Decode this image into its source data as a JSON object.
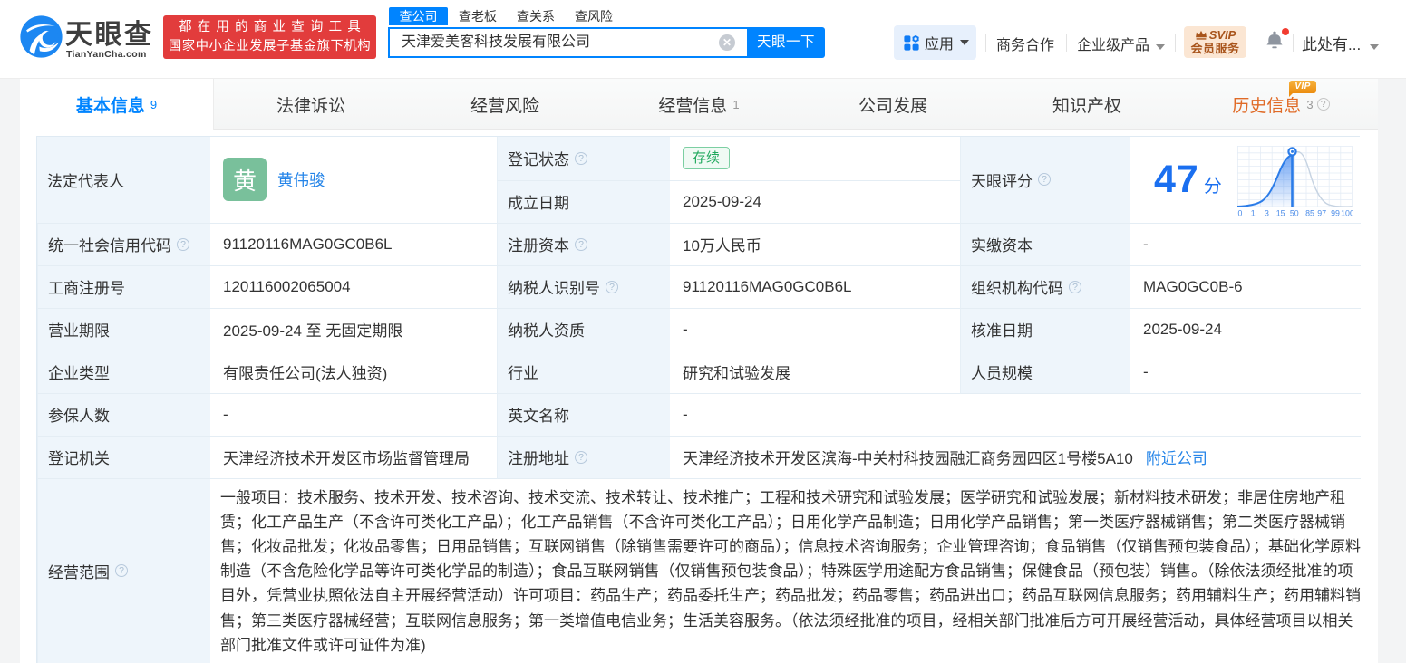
{
  "header": {
    "logo": {
      "title": "天眼查",
      "subtitle": "TianYanCha.com",
      "icon": "tianyancha-eye-swirl"
    },
    "slogan": {
      "line1": "都在用的商业查询工具",
      "line2": "国家中小企业发展子基金旗下机构",
      "bg_color": "#e23c3c"
    },
    "search": {
      "tabs": [
        {
          "label": "查公司",
          "active": true
        },
        {
          "label": "查老板",
          "active": false
        },
        {
          "label": "查关系",
          "active": false
        },
        {
          "label": "查风险",
          "active": false
        }
      ],
      "input_value": "天津爱美客科技发展有限公司",
      "button_label": "天眼一下",
      "accent_color": "#0084ff"
    },
    "nav": {
      "apps_label": "应用",
      "cooperation_label": "商务合作",
      "enterprise_label": "企业级产品",
      "svip": {
        "line1": "SVIP",
        "line2": "会员服务"
      },
      "bell_has_notification": true,
      "user_label": "此处有..."
    }
  },
  "tabs": [
    {
      "label": "基本信息",
      "count": "9",
      "active": true
    },
    {
      "label": "法律诉讼"
    },
    {
      "label": "经营风险"
    },
    {
      "label": "经营信息",
      "count": "1"
    },
    {
      "label": "公司发展"
    },
    {
      "label": "知识产权"
    },
    {
      "label": "历史信息",
      "count": "3",
      "vip_badge": "VIP",
      "has_help": true
    }
  ],
  "info": {
    "legal_rep": {
      "label": "法定代表人",
      "avatar_char": "黄",
      "name": "黄伟骏",
      "avatar_color": "#79c09b"
    },
    "reg_status": {
      "label": "登记状态",
      "value": "存续",
      "status_color": "#1fa85c"
    },
    "est_date": {
      "label": "成立日期",
      "value": "2025-09-24"
    },
    "score": {
      "label": "天眼评分",
      "value": "47",
      "unit": "分",
      "ticks": [
        "0",
        "1",
        "3",
        "15",
        "50",
        "85",
        "97",
        "99",
        "100"
      ]
    },
    "credit_code": {
      "label": "统一社会信用代码",
      "value": "91120116MAG0GC0B6L"
    },
    "reg_capital": {
      "label": "注册资本",
      "value": "10万人民币"
    },
    "paid_capital": {
      "label": "实缴资本",
      "value": "-"
    },
    "reg_number": {
      "label": "工商注册号",
      "value": "120116002065004"
    },
    "taxpayer_id": {
      "label": "纳税人识别号",
      "value": "91120116MAG0GC0B6L"
    },
    "org_code": {
      "label": "组织机构代码",
      "value": "MAG0GC0B-6"
    },
    "business_term": {
      "label": "营业期限",
      "value": "2025-09-24 至 无固定期限"
    },
    "taxpayer_quality": {
      "label": "纳税人资质",
      "value": "-"
    },
    "approval_date": {
      "label": "核准日期",
      "value": "2025-09-24"
    },
    "company_type": {
      "label": "企业类型",
      "value": "有限责任公司(法人独资)"
    },
    "industry": {
      "label": "行业",
      "value": "研究和试验发展"
    },
    "staff_size": {
      "label": "人员规模",
      "value": "-"
    },
    "insured_count": {
      "label": "参保人数",
      "value": "-"
    },
    "english_name": {
      "label": "英文名称",
      "value": "-"
    },
    "reg_authority": {
      "label": "登记机关",
      "value": "天津经济技术开发区市场监督管理局"
    },
    "reg_address": {
      "label": "注册地址",
      "value": "天津经济技术开发区滨海-中关村科技园融汇商务园四区1号楼5A10",
      "link": "附近公司"
    },
    "business_scope": {
      "label": "经营范围",
      "value": "一般项目：技术服务、技术开发、技术咨询、技术交流、技术转让、技术推广；工程和技术研究和试验发展；医学研究和试验发展；新材料技术研发；非居住房地产租赁；化工产品生产（不含许可类化工产品）；化工产品销售（不含许可类化工产品）；日用化学产品制造；日用化学产品销售；第一类医疗器械销售；第二类医疗器械销售；化妆品批发；化妆品零售；日用品销售；互联网销售（除销售需要许可的商品）；信息技术咨询服务；企业管理咨询；食品销售（仅销售预包装食品）；基础化学原料制造（不含危险化学品等许可类化学品的制造）；食品互联网销售（仅销售预包装食品）；特殊医学用途配方食品销售；保健食品（预包装）销售。（除依法须经批准的项目外，凭营业执照依法自主开展经营活动）许可项目：药品生产；药品委托生产；药品批发；药品零售；药品进出口；药品互联网信息服务；药用辅料生产；药用辅料销售；第三类医疗器械经营；互联网信息服务；第一类增值电信业务；生活美容服务。（依法须经批准的项目，经相关部门批准后方可开展经营活动，具体经营项目以相关部门批准文件或许可证件为准)"
    }
  }
}
